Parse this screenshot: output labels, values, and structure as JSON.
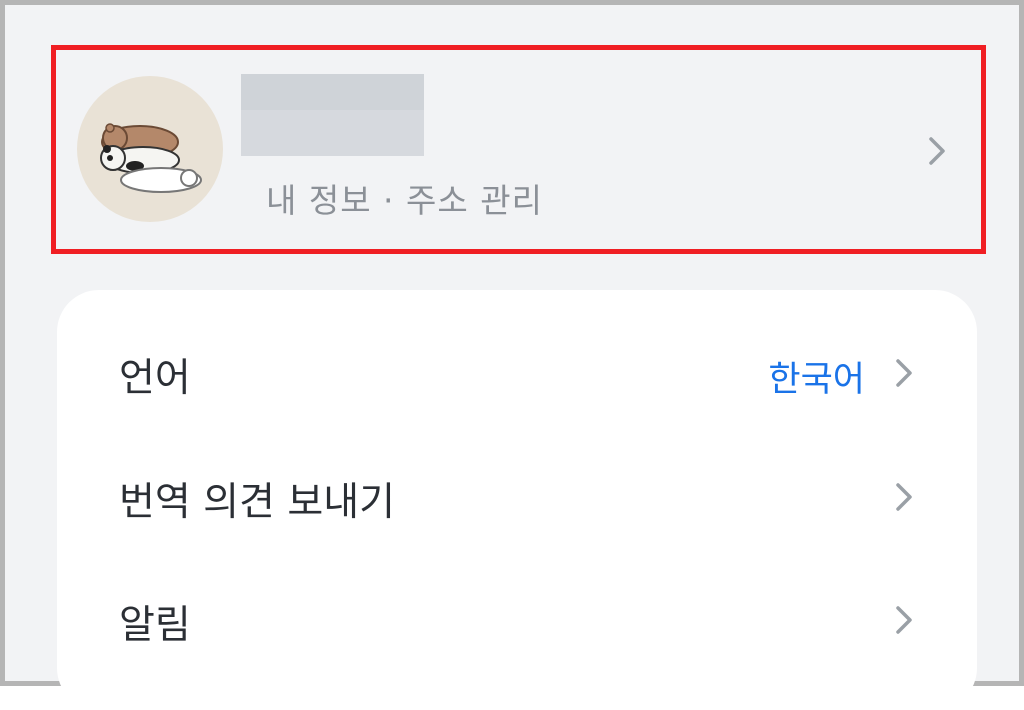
{
  "profile": {
    "name": "",
    "subtitle": "내 정보 · 주소 관리",
    "avatar_icon": "avatar-bears-illustration",
    "chevron_icon": "chevron-right-icon"
  },
  "settings": [
    {
      "label": "언어",
      "value": "한국어"
    },
    {
      "label": "번역 의견 보내기",
      "value": ""
    },
    {
      "label": "알림",
      "value": ""
    }
  ],
  "colors": {
    "background": "#f2f3f5",
    "card": "#ffffff",
    "accent": "#1a73e8",
    "highlight_border": "#f01e23",
    "chevron": "#9aa0a6"
  }
}
